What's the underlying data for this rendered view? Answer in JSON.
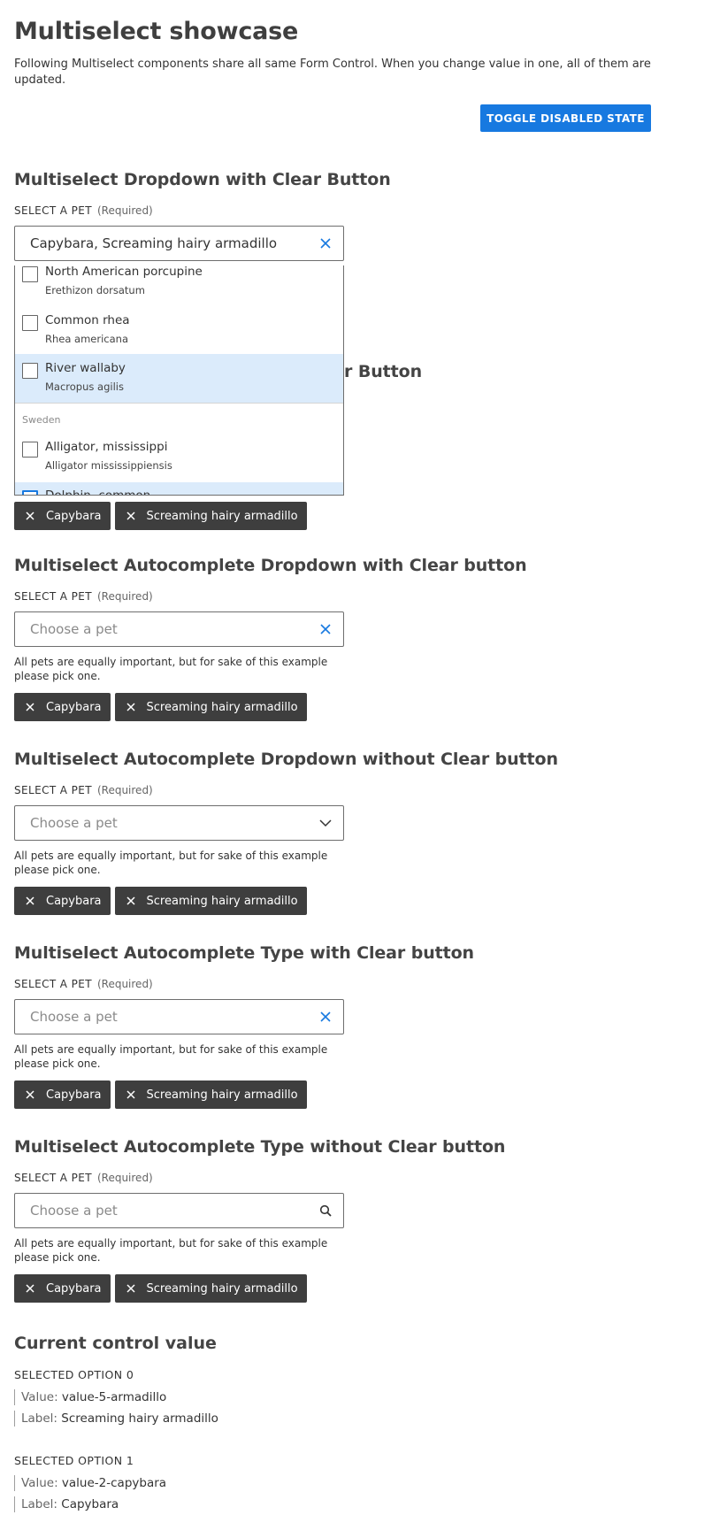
{
  "page": {
    "title": "Multiselect showcase",
    "intro": "Following Multiselect components share all same Form Control. When you change value in one, all of them are updated.",
    "toggle_label": "TOGGLE DISABLED STATE"
  },
  "field": {
    "label": "SELECT A PET",
    "required": "(Required)",
    "placeholder": "Choose a pet",
    "hint": "All pets are equally important, but for sake of this example please pick one."
  },
  "chips": [
    "Capybara",
    "Screaming hairy armadillo"
  ],
  "sections": [
    {
      "heading": "Multiselect Dropdown with Clear Button",
      "value": "Capybara, Screaming hairy armadillo",
      "icon": "clear-icon"
    },
    {
      "heading": "Multiselect Dropdown without Clear Button",
      "icon": "chevron-down-icon"
    },
    {
      "heading": "Multiselect Autocomplete Dropdown with Clear button",
      "icon": "clear-icon"
    },
    {
      "heading": "Multiselect Autocomplete Dropdown without Clear button",
      "icon": "chevron-down-icon"
    },
    {
      "heading": "Multiselect Autocomplete Type with Clear button",
      "icon": "clear-icon"
    },
    {
      "heading": "Multiselect Autocomplete Type without Clear button",
      "icon": "search-icon"
    }
  ],
  "dropdown": {
    "options": [
      {
        "name": "North American porcupine",
        "latin": "Erethizon dorsatum"
      },
      {
        "name": "Common rhea",
        "latin": "Rhea americana"
      },
      {
        "name": "River wallaby",
        "latin": "Macropus agilis",
        "highlighted": true
      },
      {
        "name": "Alligator, mississippi",
        "latin": "Alligator mississippiensis"
      },
      {
        "name": "Dolphin, common",
        "highlighted": true,
        "focused": true
      }
    ],
    "group_label": "Sweden"
  },
  "current_value": {
    "title": "Current control value",
    "items": [
      {
        "heading": "SELECTED OPTION 0",
        "value_key": "Value:",
        "value": "value-5-armadillo",
        "label_key": "Label:",
        "label": "Screaming hairy armadillo"
      },
      {
        "heading": "SELECTED OPTION 1",
        "value_key": "Value:",
        "value": "value-2-capybara",
        "label_key": "Label:",
        "label": "Capybara"
      }
    ]
  },
  "colors": {
    "primary": "#1779e0",
    "chip_bg": "#3e3e3e",
    "highlight": "#dbebfb",
    "text": "#333333"
  }
}
